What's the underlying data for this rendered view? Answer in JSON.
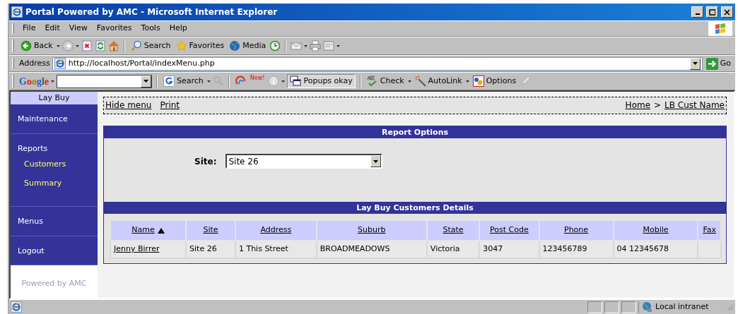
{
  "window": {
    "title": "Portal Powered by AMC - Microsoft Internet Explorer"
  },
  "menu_bar": [
    "File",
    "Edit",
    "View",
    "Favorites",
    "Tools",
    "Help"
  ],
  "toolbar": {
    "back": "Back",
    "search": "Search",
    "favorites": "Favorites",
    "media": "Media"
  },
  "address_bar": {
    "label": "Address",
    "url": "http://localhost/Portal/indexMenu.php",
    "go": "Go"
  },
  "google_toolbar": {
    "brand": "Google",
    "search": "Search",
    "new_badge": "New!",
    "popups": "Popups okay",
    "check": "Check",
    "autolink": "AutoLink",
    "options": "Options"
  },
  "sidebar": {
    "header": "Lay Buy",
    "items": [
      {
        "label": "Maintenance"
      },
      {
        "label": "Reports",
        "children": [
          {
            "label": "Customers"
          },
          {
            "label": "Summary"
          }
        ]
      },
      {
        "label": "Menus"
      },
      {
        "label": "Logout"
      }
    ],
    "footer": "Powered by AMC"
  },
  "top_bar": {
    "links": [
      "Hide menu",
      "Print"
    ],
    "breadcrumb": [
      "Home",
      "LB Cust Name"
    ],
    "separator": ">"
  },
  "report_options": {
    "title": "Report Options",
    "site_label": "Site:",
    "site_value": "Site 26"
  },
  "table": {
    "title": "Lay Buy Customers Details",
    "columns": [
      {
        "label": "Name",
        "sorted": true
      },
      {
        "label": "Site",
        "sorted": false
      },
      {
        "label": "Address",
        "sorted": false
      },
      {
        "label": "Suburb",
        "sorted": false
      },
      {
        "label": "State",
        "sorted": false
      },
      {
        "label": "Post Code",
        "sorted": false
      },
      {
        "label": "Phone",
        "sorted": false
      },
      {
        "label": "Mobile",
        "sorted": false
      },
      {
        "label": "Fax",
        "sorted": false
      }
    ],
    "rows": [
      {
        "cells": [
          {
            "text": "Jenny Birrer",
            "link": true
          },
          {
            "text": "Site 26",
            "link": false
          },
          {
            "text": "1 This Street",
            "link": false
          },
          {
            "text": "BROADMEADOWS",
            "link": false
          },
          {
            "text": "Victoria",
            "link": false
          },
          {
            "text": "3047",
            "link": false
          },
          {
            "text": "123456789",
            "link": false
          },
          {
            "text": "04 12345678",
            "link": false
          }
        ]
      }
    ]
  },
  "status_bar": {
    "zone": "Local intranet"
  }
}
